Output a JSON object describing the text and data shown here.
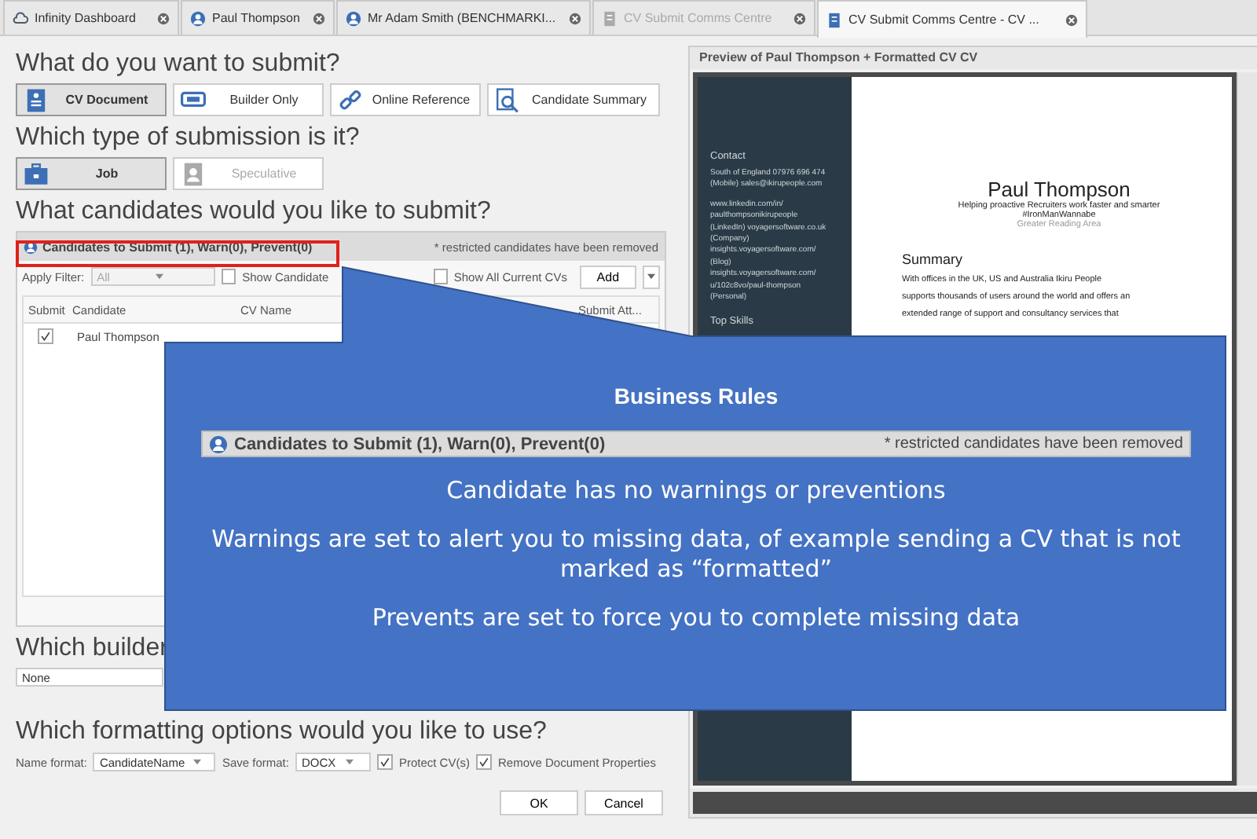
{
  "tabs": [
    {
      "label": "Infinity Dashboard",
      "selected": false,
      "dimmed": false
    },
    {
      "label": "Paul Thompson",
      "selected": false,
      "dimmed": false
    },
    {
      "label": "Mr Adam Smith (BENCHMARKI...",
      "selected": false,
      "dimmed": false
    },
    {
      "label": "CV Submit Comms Centre",
      "selected": false,
      "dimmed": true
    },
    {
      "label": "CV Submit Comms Centre - CV ...",
      "selected": true,
      "dimmed": false
    }
  ],
  "submit_section": {
    "heading": "What do you want to submit?",
    "options": [
      {
        "label": "CV Document",
        "selected": true,
        "disabled": false
      },
      {
        "label": "Builder Only",
        "selected": false,
        "disabled": false
      },
      {
        "label": "Online Reference",
        "selected": false,
        "disabled": false
      },
      {
        "label": "Candidate Summary",
        "selected": false,
        "disabled": false
      }
    ]
  },
  "type_section": {
    "heading": "Which type of submission is it?",
    "options": [
      {
        "label": "Job",
        "selected": true,
        "disabled": false
      },
      {
        "label": "Speculative",
        "selected": false,
        "disabled": true
      }
    ]
  },
  "candidates_section": {
    "heading": "What candidates would you like to submit?",
    "summary": "Candidates to Submit (1), Warn(0), Prevent(0)",
    "note": "* restricted candidates have been removed",
    "filter_label": "Apply Filter:",
    "filter_value": "All",
    "show_candidate": {
      "label": "Show Candidate",
      "checked": false
    },
    "show_all": {
      "label": "Show All Current CVs",
      "checked": false
    },
    "add_button": "Add",
    "columns": [
      "Submit",
      "Candidate",
      "CV Name",
      "Submit Att..."
    ],
    "rows": [
      {
        "checked": true,
        "candidate": "Paul Thompson"
      }
    ]
  },
  "builder_section": {
    "heading": "Which builder",
    "value": "None"
  },
  "formatting_section": {
    "heading": "Which formatting options would you like to use?",
    "name_format_label": "Name format:",
    "name_format": "CandidateName",
    "save_format_label": "Save format:",
    "save_format": "DOCX",
    "options": [
      {
        "label": "Protect CV(s)",
        "checked": true
      },
      {
        "label": "Remove Document Properties",
        "checked": true
      }
    ]
  },
  "buttons": [
    "OK",
    "Cancel"
  ],
  "preview": {
    "title": "Preview of Paul Thompson + Formatted CV CV",
    "sidebar": [
      {
        "kind": "heading",
        "text": "Contact"
      },
      {
        "kind": "line",
        "text": "South of England 07976 696 474"
      },
      {
        "kind": "line",
        "text": "(Mobile) sales@ikirupeople.com"
      },
      {
        "kind": "gap"
      },
      {
        "kind": "line",
        "text": "www.linkedin.com/in/"
      },
      {
        "kind": "line",
        "text": "paulthompsonikirupeople"
      },
      {
        "kind": "line",
        "text": "(LinkedIn) voyagersoftware.co.uk"
      },
      {
        "kind": "line",
        "text": "(Company)"
      },
      {
        "kind": "line",
        "text": "insights.voyagersoftware.com/"
      },
      {
        "kind": "line",
        "text": "(Blog)"
      },
      {
        "kind": "line",
        "text": "insights.voyagersoftware.com/"
      },
      {
        "kind": "line",
        "text": "u/102c8vo/paul-thompson"
      },
      {
        "kind": "line",
        "text": "(Personal)"
      },
      {
        "kind": "gap"
      },
      {
        "kind": "heading",
        "text": "Top Skills"
      }
    ],
    "name": "Paul Thompson",
    "tagline": "Helping proactive Recruiters work faster and smarter",
    "tag": "#IronManWannabe",
    "location": "Greater Reading Area",
    "summary_heading": "Summary",
    "summary_lines": [
      "With offices in the UK, US and Australia Ikiru People",
      "supports thousands of users around the world and offers an",
      "extended range of support and consultancy services that"
    ]
  },
  "callout": {
    "title": "Business Rules",
    "summary": "Candidates to Submit (1), Warn(0), Prevent(0)",
    "note": "* restricted candidates have been removed",
    "paragraphs": [
      "Candidate has no warnings or preventions",
      "Warnings are set to alert you to missing data, of example sending a CV that is not marked as “formatted”",
      "Prevents are set to force you to complete missing data"
    ]
  }
}
